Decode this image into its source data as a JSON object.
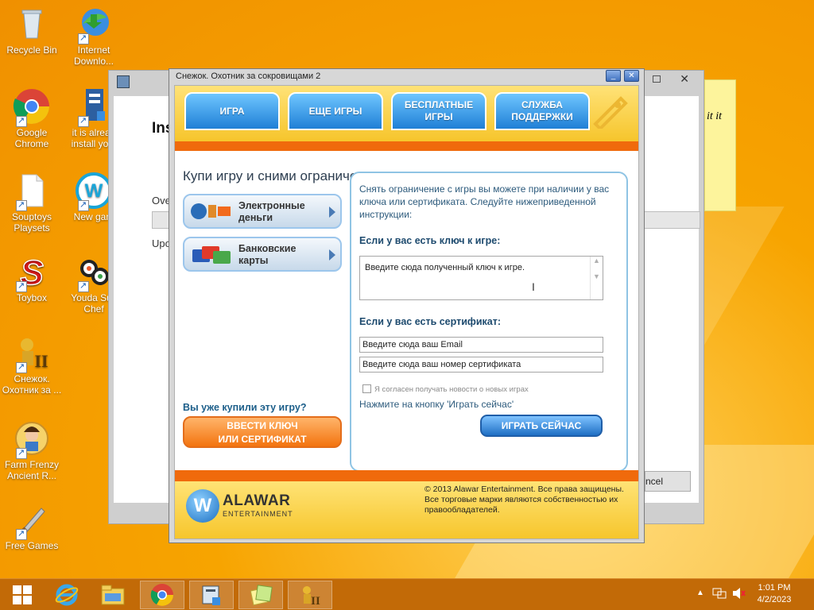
{
  "desktop": {
    "icons": [
      {
        "label": "Recycle Bin",
        "icon": "recycle-bin-icon"
      },
      {
        "label": "Internet Downlo...",
        "icon": "download-manager-icon"
      },
      {
        "label": "Google Chrome",
        "icon": "chrome-icon"
      },
      {
        "label": "it is alread install yo...",
        "icon": "installer-icon"
      },
      {
        "label": "Souptoys Playsets",
        "icon": "document-icon"
      },
      {
        "label": "New gam",
        "icon": "wildtangent-icon"
      },
      {
        "label": "Toybox",
        "icon": "toybox-icon"
      },
      {
        "label": "Youda Sus Chef",
        "icon": "sushi-icon"
      },
      {
        "label": "Снежок. Охотник за ...",
        "icon": "snowball-game-icon"
      },
      {
        "label": "Farm Frenzy Ancient R...",
        "icon": "farm-frenzy-icon"
      },
      {
        "label": "Free Games",
        "icon": "free-games-icon"
      }
    ]
  },
  "background_window": {
    "title_fragment": "Ins",
    "label1": "Ove",
    "label2": "Upo",
    "cancel_fragment": "ncel",
    "sticky_text": "it it"
  },
  "window": {
    "title": "Снежок. Охотник за сокровищами 2",
    "minimize": "_",
    "close": "✕",
    "tabs": [
      "ИГРА",
      "ЕЩЕ ИГРЫ",
      "БЕСПЛАТНЫЕ ИГРЫ",
      "СЛУЖБА ПОДДЕРЖКИ"
    ],
    "heading": "Купи игру и сними ограничения:",
    "pay_options": [
      {
        "line1": "Электронные",
        "line2": "деньги"
      },
      {
        "line1": "Банковские",
        "line2": "карты"
      }
    ],
    "already_bought": "Вы уже купили эту игру?",
    "enter_key_button": {
      "line1": "ВВЕСТИ КЛЮЧ",
      "line2": "ИЛИ СЕРТИФИКАТ"
    },
    "panel": {
      "intro": "Снять ограничение с игры вы можете при наличии у вас ключа или сертификата. Следуйте нижеприведенной инструкции:",
      "key_heading": "Если у вас есть ключ к игре:",
      "key_placeholder": "Введите сюда полученный ключ к игре.",
      "cert_heading": "Если у вас есть сертификат:",
      "email_placeholder": "Введите сюда ваш Email",
      "cert_placeholder": "Введите сюда ваш номер сертификата",
      "agree_label": "Я согласен получать новости о новых играх",
      "press_text": "Нажмите на кнопку 'Играть сейчас'",
      "play_button": "ИГРАТЬ СЕЙЧАС"
    },
    "footer": {
      "logo_main": "ALAWAR",
      "logo_sub": "ENTERTAINMENT",
      "copyright": "© 2013 Alawar Entertainment. Все права защищены. Все торговые марки являются собственностью их правообладателей."
    }
  },
  "taskbar": {
    "items": [
      "start-icon",
      "internet-explorer-icon",
      "file-explorer-icon",
      "chrome-icon",
      "installer-icon",
      "sticky-notes-icon",
      "snowball-game-icon"
    ],
    "time": "1:01 PM",
    "date": "4/2/2023"
  },
  "colors": {
    "accent_orange": "#f06a0c",
    "tab_blue": "#1f7fd6",
    "header_yellow": "#f6c52c",
    "taskbar": "#c26a07"
  }
}
